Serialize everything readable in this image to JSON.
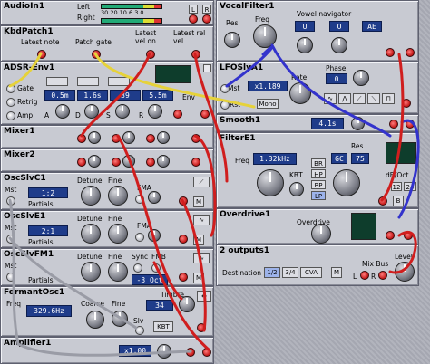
{
  "modules": {
    "audioin": {
      "title": "AudioIn1",
      "left": "Left",
      "right": "Right",
      "meter_scale": "30 20 10 6 3 0",
      "l_btn": "L",
      "r_btn": "R"
    },
    "kbdpatch": {
      "title": "KbdPatch1",
      "latest_note": "Latest note",
      "patch_gate": "Patch gate",
      "latest_vel_on": "Latest vel on",
      "latest_rel_vel": "Latest rel vel"
    },
    "adsr": {
      "title": "ADSR-Env1",
      "gate": "Gate",
      "retrig": "Retrig",
      "amp": "Amp",
      "a_val": "0.5m",
      "d_val": "1.6s",
      "s_val": "39",
      "r_val": "5.5m",
      "inv": "Env",
      "a": "A",
      "d": "D",
      "s": "S",
      "r": "R"
    },
    "mixer1": {
      "title": "Mixer1"
    },
    "mixer2": {
      "title": "Mixer2"
    },
    "oscslvc": {
      "title": "OscSlvC1",
      "mst": "Mst",
      "detune": "Detune",
      "fine": "Fine",
      "ratio": "1:2",
      "partials": "Partials",
      "fma": "FMA",
      "m": "M"
    },
    "oscslve": {
      "title": "OscSlvE1",
      "mst": "Mst",
      "detune": "Detune",
      "fine": "Fine",
      "ratio": "2:1",
      "partials": "Partials",
      "fma": "FMA",
      "m": "M"
    },
    "oscslvfm": {
      "title": "OscSlvFM1",
      "mst": "Mst",
      "detune": "Detune",
      "fine": "Fine",
      "sync": "Sync",
      "fmb": "FMB",
      "oct": "-3 Oct",
      "partials": "Partials",
      "m": "M"
    },
    "formant": {
      "title": "FormantOsc1",
      "freq": "Freq",
      "freq_val": "329.6Hz",
      "coarse": "Coarse",
      "fine": "Fine",
      "timbre": "Timbre",
      "timbre_val": "34",
      "slv": "Slv",
      "kbt": "KBT"
    },
    "amplifier": {
      "title": "Amplifier1",
      "value": "x1.00"
    },
    "vocalfilter": {
      "title": "VocalFilter1",
      "vowel_navigator": "Vowel navigator",
      "res": "Res",
      "freq": "Freq",
      "u": "U",
      "o": "O",
      "ae": "AE"
    },
    "lfo": {
      "title": "LFOSlvA1",
      "rate": "Rate",
      "phase": "Phase",
      "phase_val": "0",
      "mst": "Mst",
      "ratio": "x1.189",
      "rst": "Rst",
      "mono": "Mono"
    },
    "smooth": {
      "title": "Smooth1",
      "value": "4.1s"
    },
    "filtere": {
      "title": "FilterE1",
      "freq": "Freq",
      "freq_val": "1.32kHz",
      "res": "Res",
      "gc": "GC",
      "res_val": "75",
      "kbt": "KBT",
      "br": "BR",
      "hp": "HP",
      "bp": "BP",
      "lp": "LP",
      "db_oct": "dB/Oct",
      "slope_12": "12",
      "slope_24": "24",
      "b": "B"
    },
    "overdrive": {
      "title": "Overdrive1",
      "overdrive": "Overdrive"
    },
    "outputs": {
      "title": "2 outputs1",
      "destination": "Destination",
      "d12": "1/2",
      "d34": "3/4",
      "cva": "CVA",
      "m": "M",
      "mix_bus": "Mix Bus",
      "level": "Level",
      "l": "L",
      "r": "R"
    }
  },
  "colors": {
    "cable_red": "#d01e1e",
    "cable_blue": "#3333cc",
    "cable_yellow": "#e6d23a",
    "cable_gray": "#9a9ca6",
    "display_blue": "#1f3c8a",
    "jack_red": "#d01818"
  }
}
